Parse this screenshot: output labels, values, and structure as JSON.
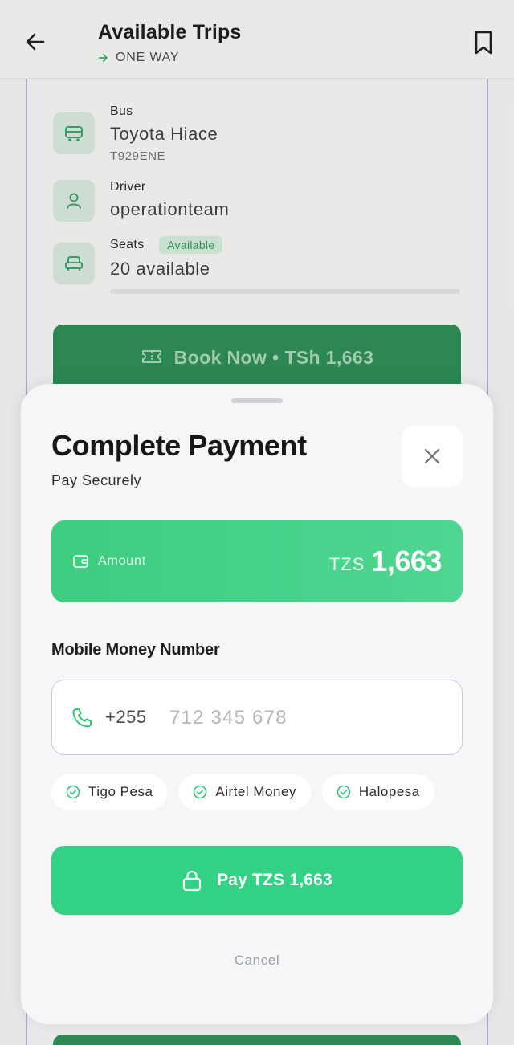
{
  "header": {
    "title": "Available Trips",
    "trip_type": "ONE WAY",
    "back_icon": "arrow-left-icon",
    "bookmark_icon": "bookmark-icon"
  },
  "trip": {
    "bus": {
      "label": "Bus",
      "value": "Toyota  Hiace",
      "plate": "T929ENE",
      "icon": "bus-icon"
    },
    "driver": {
      "label": "Driver",
      "value": "operationteam",
      "icon": "user-icon"
    },
    "seats": {
      "label": "Seats",
      "badge": "Available",
      "value": "20 available",
      "icon": "seat-icon"
    },
    "book_button": "Book Now • TSh  1,663"
  },
  "payment_modal": {
    "title": "Complete Payment",
    "subtitle": "Pay Securely",
    "amount": {
      "label": "Amount",
      "currency": "TZS",
      "value": "1,663",
      "icon": "wallet-icon"
    },
    "mobile_money": {
      "label": "Mobile Money Number",
      "country_code": "+255",
      "placeholder": "712 345 678",
      "value": ""
    },
    "providers": [
      "Tigo Pesa",
      "Airtel Money",
      "Halopesa"
    ],
    "pay_button": "Pay TZS 1,663",
    "cancel": "Cancel"
  },
  "colors": {
    "accent_green": "#33d185",
    "dark_green": "#2d8d56",
    "modal_bg": "#f5f6f8",
    "badge_green": "#2f9a5a"
  }
}
